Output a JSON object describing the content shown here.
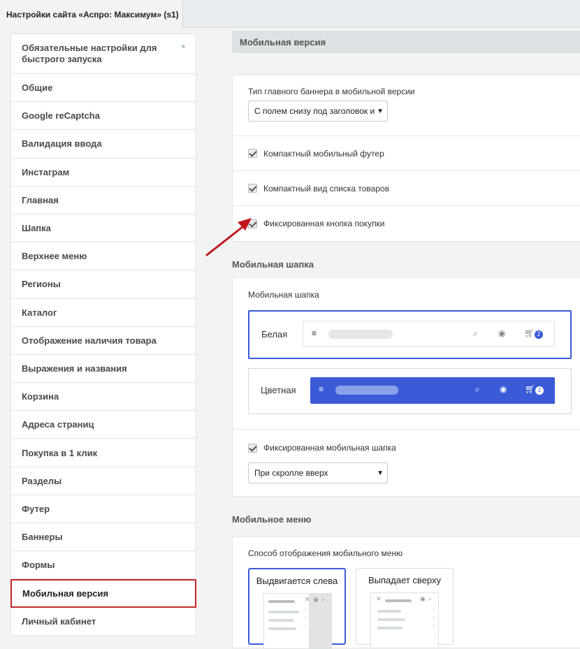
{
  "tab": {
    "title": "Настройки сайта «Аспро: Максимум» (s1)"
  },
  "sidebar": {
    "items": [
      {
        "label": "Обязательные настройки для быстрого запуска",
        "star": "*"
      },
      {
        "label": "Общие"
      },
      {
        "label": "Google reCaptcha"
      },
      {
        "label": "Валидация ввода"
      },
      {
        "label": "Инстаграм"
      },
      {
        "label": "Главная"
      },
      {
        "label": "Шапка"
      },
      {
        "label": "Верхнее меню"
      },
      {
        "label": "Регионы"
      },
      {
        "label": "Каталог"
      },
      {
        "label": "Отображение наличия товара"
      },
      {
        "label": "Выражения и названия"
      },
      {
        "label": "Корзина"
      },
      {
        "label": "Адреса страниц"
      },
      {
        "label": "Покупка в 1 клик"
      },
      {
        "label": "Разделы"
      },
      {
        "label": "Футер"
      },
      {
        "label": "Баннеры"
      },
      {
        "label": "Формы"
      },
      {
        "label": "Мобильная версия"
      },
      {
        "label": "Личный кабинет"
      }
    ],
    "active_index": 19
  },
  "main": {
    "section_title": "Мобильная версия",
    "banner": {
      "label": "Тип главного баннера в мобильной версии",
      "value": "С полем снизу под заголовок и"
    },
    "checks": [
      {
        "label": "Компактный мобильный футер",
        "checked": true
      },
      {
        "label": "Компактный вид списка товаров",
        "checked": true
      },
      {
        "label": "Фиксированная кнопка покупки",
        "checked": true
      }
    ],
    "mobile_header": {
      "group_title": "Мобильная шапка",
      "label": "Мобильная шапка",
      "options": [
        {
          "label": "Белая",
          "selected": true,
          "cart_count": "2"
        },
        {
          "label": "Цветная",
          "selected": false,
          "cart_count": "2"
        }
      ],
      "fixed_label": "Фиксированная мобильная шапка",
      "fixed_checked": true,
      "fixed_select": "При скролле вверх"
    },
    "mobile_menu": {
      "group_title": "Мобильное меню",
      "label": "Способ отображения мобильного меню",
      "options": [
        {
          "label": "Выдвигается слева",
          "selected": true
        },
        {
          "label": "Выпадает сверху",
          "selected": false
        }
      ]
    }
  },
  "colors": {
    "accent_blue": "#3a5ad8",
    "active_border": "#c1272d",
    "arrow": "#c0151d"
  },
  "icons": [
    "star-icon",
    "checkbox-icon",
    "dropdown-arrow-icon",
    "hamburger-icon",
    "search-icon",
    "user-icon",
    "cart-icon",
    "close-icon",
    "chevron-right-icon",
    "annotation-arrow"
  ]
}
